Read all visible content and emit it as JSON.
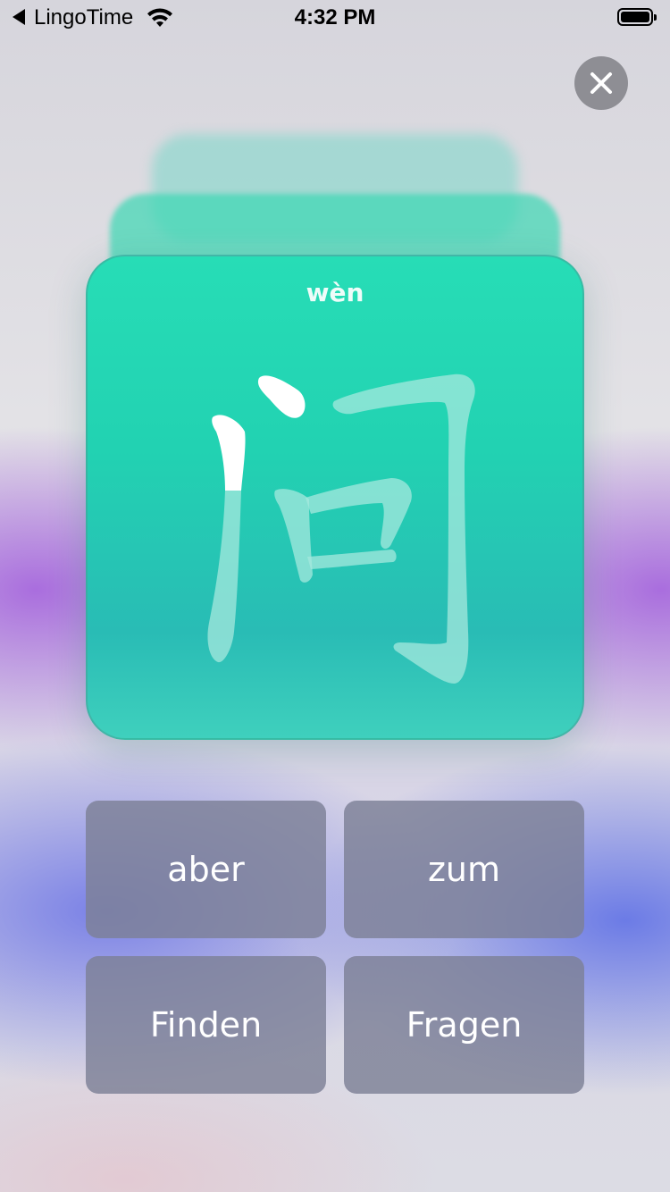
{
  "status_bar": {
    "back_app": "LingoTime",
    "time": "4:32 PM"
  },
  "card": {
    "pinyin": "wèn",
    "character": "问",
    "accent_color": "#27ddb6"
  },
  "answers": [
    {
      "label": "aber"
    },
    {
      "label": "zum"
    },
    {
      "label": "Finden"
    },
    {
      "label": "Fragen"
    }
  ],
  "icons": {
    "close": "close-icon",
    "back": "back-arrow-icon",
    "wifi": "wifi-icon",
    "battery": "battery-icon"
  }
}
